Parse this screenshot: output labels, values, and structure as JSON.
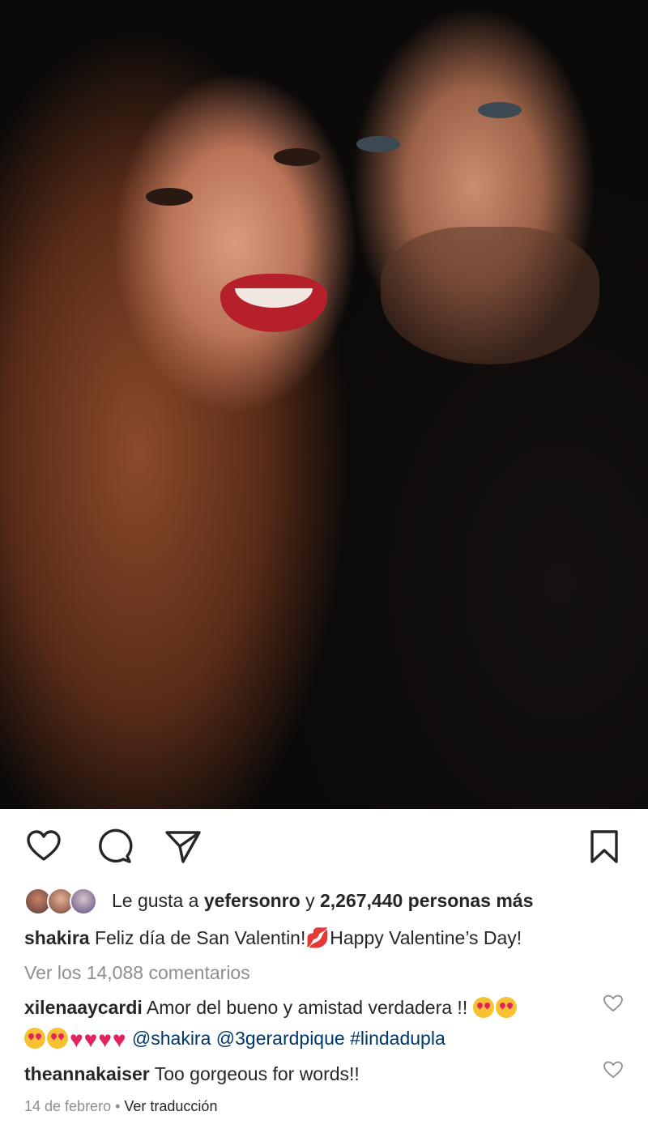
{
  "post": {
    "actions": {
      "like_icon": "heart-outline-icon",
      "comment_icon": "comment-bubble-icon",
      "share_icon": "paper-plane-icon",
      "save_icon": "bookmark-icon"
    },
    "likes": {
      "prefix": "Le gusta a",
      "first_user": "yefersonro",
      "connector": "y",
      "count_text": "2,267,440 personas más"
    },
    "caption": {
      "username": "shakira",
      "text_before": "Feliz día de San Valentin!",
      "emoji": "💋",
      "text_after": "Happy Valentine’s Day!"
    },
    "view_comments": "Ver los 14,088 comentarios",
    "comments": [
      {
        "username": "xilenaaycardi",
        "text": "Amor del bueno y amistad verdadera !!",
        "mentions": [
          "@shakira",
          "@3gerardpique",
          "#lindadupla"
        ]
      },
      {
        "username": "theannakaiser",
        "text": "Too gorgeous for words!!"
      }
    ],
    "date": "14 de febrero",
    "separator": "•",
    "translate": "Ver traducción"
  },
  "colors": {
    "text": "#262626",
    "muted": "#8e8e8e",
    "link": "#00376b",
    "heart": "#e0245e"
  }
}
